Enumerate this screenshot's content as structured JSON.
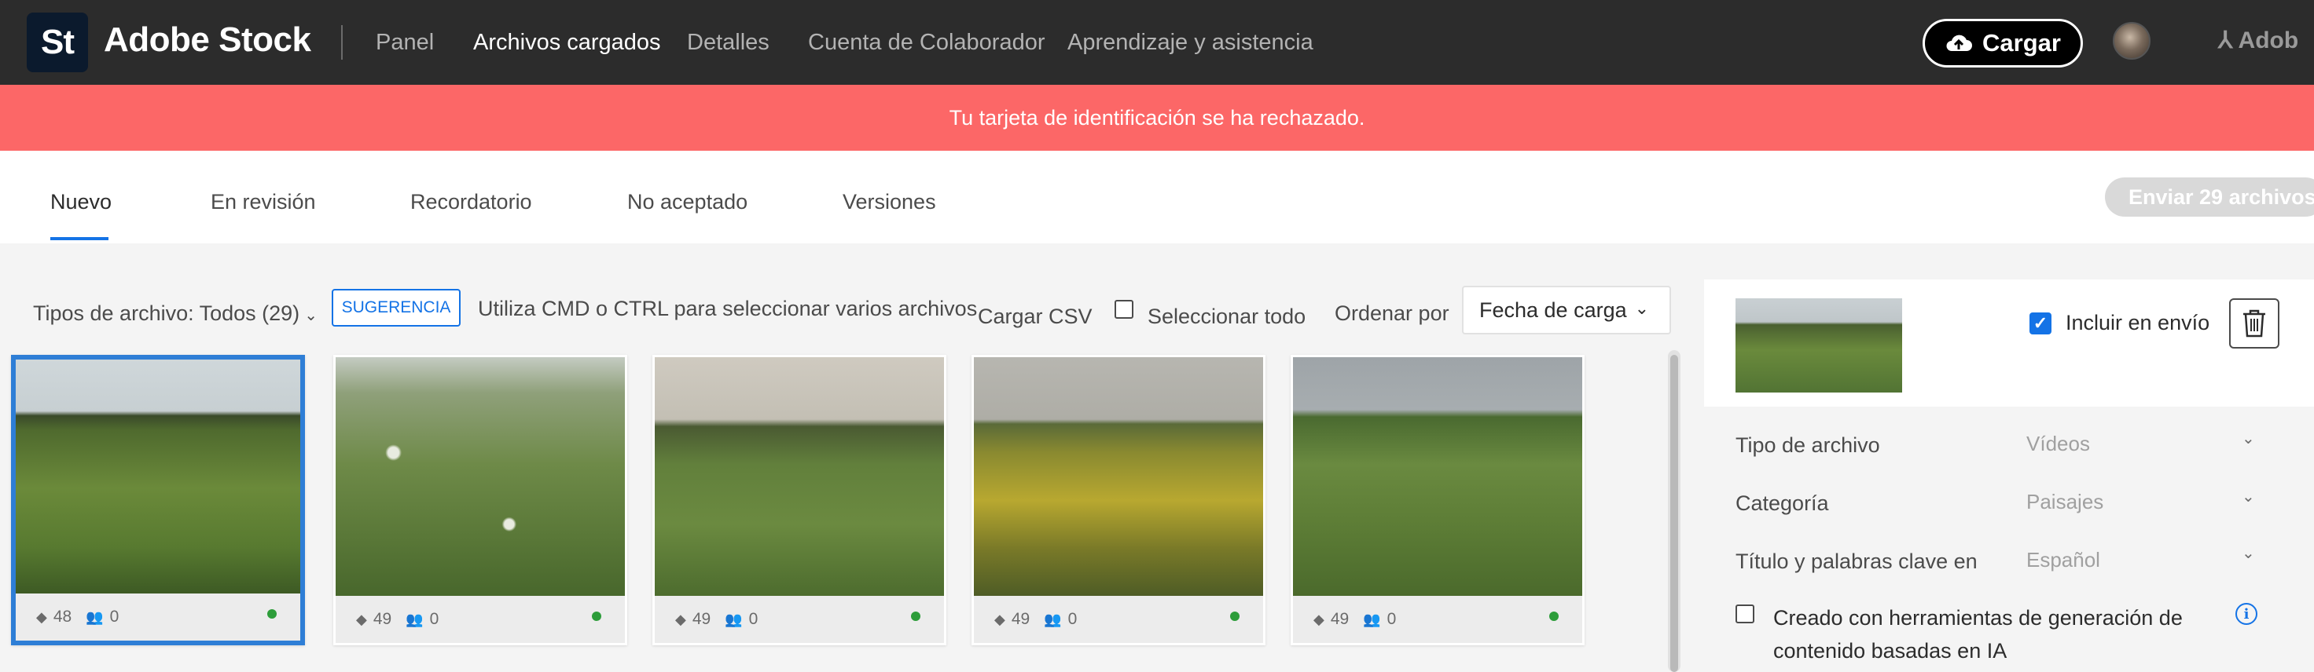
{
  "header": {
    "logo_text": "St",
    "brand": "Adobe Stock",
    "nav": [
      "Panel",
      "Archivos cargados",
      "Detalles",
      "Cuenta de Colaborador",
      "Aprendizaje y asistencia"
    ],
    "upload_label": "Cargar",
    "adobe_label": "Adob"
  },
  "banner": {
    "message": "Tu tarjeta de identificación se ha rechazado."
  },
  "tabs": {
    "items": [
      "Nuevo",
      "En revisión",
      "Recordatorio",
      "No aceptado",
      "Versiones"
    ],
    "active": "Nuevo",
    "submit_label": "Enviar 29 archivos"
  },
  "toolbar": {
    "file_types": "Tipos de archivo: Todos (29)",
    "tip_badge": "SUGERENCIA",
    "tip_text": "Utiliza CMD o CTRL para seleccionar varios archivos",
    "csv": "Cargar CSV",
    "select_all": "Seleccionar todo",
    "sort_label": "Ordenar por",
    "sort_value": "Fecha de carga"
  },
  "thumbnails": [
    {
      "keywords": "48",
      "people": "0",
      "selected": true
    },
    {
      "keywords": "49",
      "people": "0",
      "selected": false
    },
    {
      "keywords": "49",
      "people": "0",
      "selected": false
    },
    {
      "keywords": "49",
      "people": "0",
      "selected": false
    },
    {
      "keywords": "49",
      "people": "0",
      "selected": false
    }
  ],
  "panel": {
    "include_label": "Incluir en envío",
    "include_checked": true,
    "fields": [
      {
        "label": "Tipo de archivo",
        "value": "Vídeos"
      },
      {
        "label": "Categoría",
        "value": "Paisajes"
      },
      {
        "label": "Título y palabras clave en",
        "value": "Español"
      }
    ],
    "ai_label": "Creado con herramientas de generación de contenido basadas en IA"
  },
  "colors": {
    "accent": "#1473e6",
    "banner": "#fc6767",
    "header": "#2c2c2c",
    "status_ok": "#2d9d3a"
  }
}
